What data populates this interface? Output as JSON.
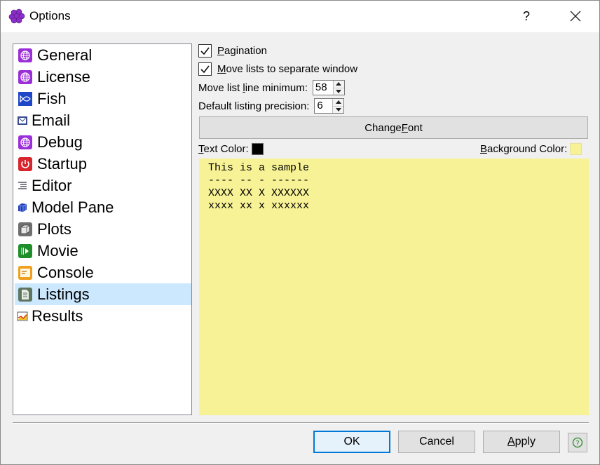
{
  "window": {
    "title": "Options",
    "help_glyph": "?"
  },
  "sidebar": {
    "items": [
      {
        "label": "General",
        "icon": "globe-icon"
      },
      {
        "label": "License",
        "icon": "globe-icon"
      },
      {
        "label": "Fish",
        "icon": "fish-icon"
      },
      {
        "label": "Email",
        "icon": "envelope-icon"
      },
      {
        "label": "Debug",
        "icon": "globe-icon"
      },
      {
        "label": "Startup",
        "icon": "power-icon"
      },
      {
        "label": "Editor",
        "icon": "text-lines-icon"
      },
      {
        "label": "Model Pane",
        "icon": "cube-icon"
      },
      {
        "label": "Plots",
        "icon": "box-icon"
      },
      {
        "label": "Movie",
        "icon": "movie-icon"
      },
      {
        "label": "Console",
        "icon": "console-icon"
      },
      {
        "label": "Listings",
        "icon": "document-icon",
        "selected": true
      },
      {
        "label": "Results",
        "icon": "chart-icon"
      }
    ]
  },
  "options": {
    "pagination": {
      "label_first": "P",
      "label_rest": "agination",
      "checked": true
    },
    "move_lists": {
      "label_first": "M",
      "label_rest": "ove lists to separate window",
      "checked": true
    },
    "line_min": {
      "label_pre": "Move list ",
      "label_u": "l",
      "label_post": "ine minimum:",
      "value": "58"
    },
    "precision": {
      "label": "Default listing precision:",
      "value": "6"
    },
    "change_font": {
      "label_pre": "Change ",
      "label_u": "F",
      "label_post": "ont"
    },
    "text_color": {
      "label_u": "T",
      "label_post": "ext Color:",
      "color": "#000000"
    },
    "bg_color": {
      "label_u": "B",
      "label_post": "ackground Color:",
      "color": "#f8f296"
    }
  },
  "sample": {
    "lines": [
      "This is a sample",
      "---- -- - ------",
      "XXXX XX X XXXXXX",
      "xxxx xx x xxxxxx"
    ]
  },
  "buttons": {
    "ok": "OK",
    "cancel": "Cancel",
    "apply_u": "A",
    "apply_rest": "pply"
  },
  "colors": {
    "accent": "#0078d7",
    "selected_bg": "#cce8ff"
  }
}
